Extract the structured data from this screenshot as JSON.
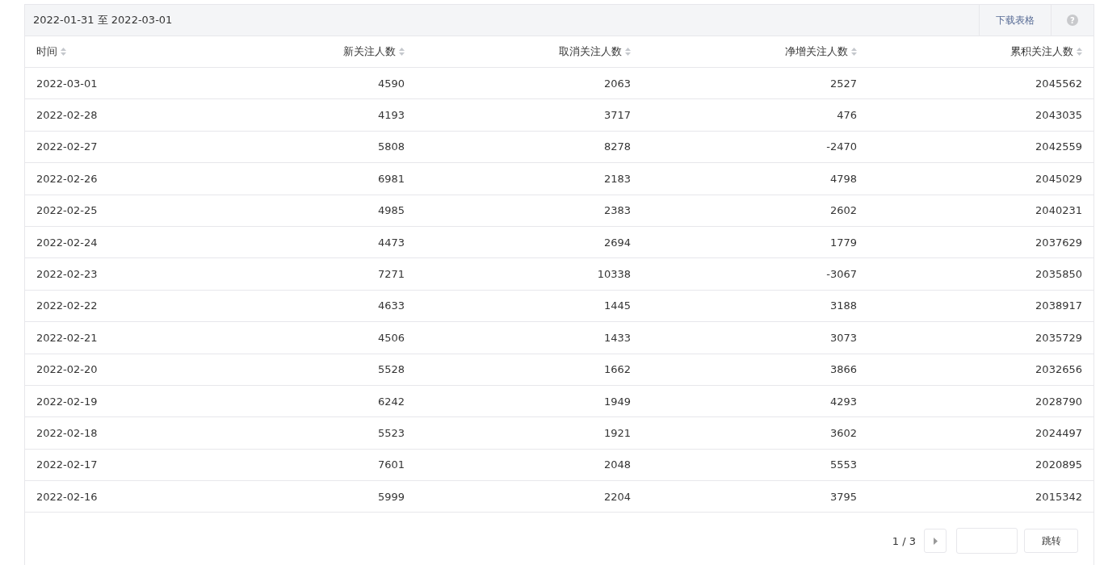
{
  "date_range": "2022-01-31 至 2022-03-01",
  "toolbar": {
    "download_label": "下载表格",
    "help_icon": "?"
  },
  "table": {
    "columns": [
      "时间",
      "新关注人数",
      "取消关注人数",
      "净增关注人数",
      "累积关注人数"
    ],
    "rows": [
      [
        "2022-03-01",
        "4590",
        "2063",
        "2527",
        "2045562"
      ],
      [
        "2022-02-28",
        "4193",
        "3717",
        "476",
        "2043035"
      ],
      [
        "2022-02-27",
        "5808",
        "8278",
        "-2470",
        "2042559"
      ],
      [
        "2022-02-26",
        "6981",
        "2183",
        "4798",
        "2045029"
      ],
      [
        "2022-02-25",
        "4985",
        "2383",
        "2602",
        "2040231"
      ],
      [
        "2022-02-24",
        "4473",
        "2694",
        "1779",
        "2037629"
      ],
      [
        "2022-02-23",
        "7271",
        "10338",
        "-3067",
        "2035850"
      ],
      [
        "2022-02-22",
        "4633",
        "1445",
        "3188",
        "2038917"
      ],
      [
        "2022-02-21",
        "4506",
        "1433",
        "3073",
        "2035729"
      ],
      [
        "2022-02-20",
        "5528",
        "1662",
        "3866",
        "2032656"
      ],
      [
        "2022-02-19",
        "6242",
        "1949",
        "4293",
        "2028790"
      ],
      [
        "2022-02-18",
        "5523",
        "1921",
        "3602",
        "2024497"
      ],
      [
        "2022-02-17",
        "7601",
        "2048",
        "5553",
        "2020895"
      ],
      [
        "2022-02-16",
        "5999",
        "2204",
        "3795",
        "2015342"
      ]
    ]
  },
  "pagination": {
    "page_label": "1 / 3",
    "jump_label": "跳转"
  }
}
